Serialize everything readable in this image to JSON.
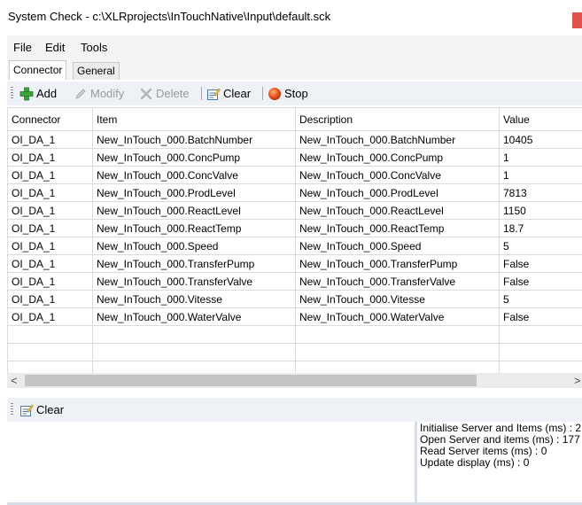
{
  "window": {
    "title": "System Check - c:\\XLRprojects\\InTouchNative\\Input\\default.sck"
  },
  "menu": [
    "File",
    "Edit",
    "Tools"
  ],
  "tabs": [
    {
      "label": "Connector",
      "active": true
    },
    {
      "label": "General",
      "active": false
    }
  ],
  "toolbar": {
    "add": "Add",
    "modify": "Modify",
    "delete": "Delete",
    "clear": "Clear",
    "stop": "Stop"
  },
  "grid": {
    "columns": [
      "Connector",
      "Item",
      "Description",
      "Value"
    ],
    "rows": [
      [
        "OI_DA_1",
        "New_InTouch_000.BatchNumber",
        "New_InTouch_000.BatchNumber",
        "10405"
      ],
      [
        "OI_DA_1",
        "New_InTouch_000.ConcPump",
        "New_InTouch_000.ConcPump",
        "1"
      ],
      [
        "OI_DA_1",
        "New_InTouch_000.ConcValve",
        "New_InTouch_000.ConcValve",
        "1"
      ],
      [
        "OI_DA_1",
        "New_InTouch_000.ProdLevel",
        "New_InTouch_000.ProdLevel",
        "7813"
      ],
      [
        "OI_DA_1",
        "New_InTouch_000.ReactLevel",
        "New_InTouch_000.ReactLevel",
        "1150"
      ],
      [
        "OI_DA_1",
        "New_InTouch_000.ReactTemp",
        "New_InTouch_000.ReactTemp",
        "18.7"
      ],
      [
        "OI_DA_1",
        "New_InTouch_000.Speed",
        "New_InTouch_000.Speed",
        "5"
      ],
      [
        "OI_DA_1",
        "New_InTouch_000.TransferPump",
        "New_InTouch_000.TransferPump",
        "False"
      ],
      [
        "OI_DA_1",
        "New_InTouch_000.TransferValve",
        "New_InTouch_000.TransferValve",
        "False"
      ],
      [
        "OI_DA_1",
        "New_InTouch_000.Vitesse",
        "New_InTouch_000.Vitesse",
        "5"
      ],
      [
        "OI_DA_1",
        "New_InTouch_000.WaterValve",
        "New_InTouch_000.WaterValve",
        "False"
      ]
    ],
    "empty_rows": 3
  },
  "scrollbar": {
    "left_arrow": "<",
    "right_arrow": ">"
  },
  "bottom_toolbar": {
    "clear": "Clear"
  },
  "log": [
    "Initialise Server and Items (ms) : 2",
    "Open Server and items (ms) : 177",
    "Read Server items (ms) : 0",
    "Update display (ms) : 0"
  ],
  "icons": {
    "add": "plus-icon",
    "modify": "pencil-icon",
    "delete": "x-icon",
    "clear": "clear-form-icon",
    "stop": "stop-circle-icon"
  },
  "colors": {
    "add_icon": "#3aa33a",
    "stop_icon": "#e8561e",
    "toolbar_bg": "#eef1f6",
    "close_button": "#e0524a"
  }
}
